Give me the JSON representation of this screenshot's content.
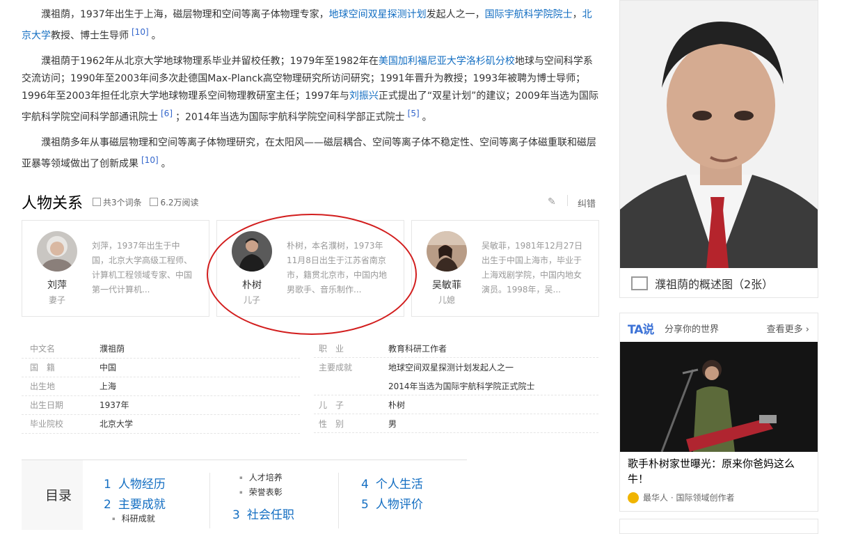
{
  "intro": {
    "p1": {
      "pre": "濮祖荫，1937年出生于上海，磁层物理和空间等离子体物理专家，",
      "link1": "地球空间双星探测计划",
      "mid1": "发起人之一，",
      "link2": "国际宇航科学院院士",
      "mid2": "，",
      "link3": "北京大学",
      "post": "教授、博士生导师",
      "ref": "[10]",
      "end": "。"
    },
    "p2": {
      "pre": "濮祖荫于1962年从北京大学地球物理系毕业并留校任教；1979年至1982年在",
      "link1": "美国加利福尼亚大学洛杉矶分校",
      "mid1": "地球与空间科学系交流访问；1990年至2003年间多次赴德国Max-Planck高空物理研究所访问研究；1991年晋升为教授；1993年被聘为博士导师；1996年至2003年担任北京大学地球物理系空间物理教研室主任；1997年与",
      "link2": "刘振兴",
      "mid2": "正式提出了“双星计划”的建议；2009年当选为国际宇航科学院空间科学部通讯院士",
      "ref1": "[6]",
      "mid3": "；2014年当选为国际宇航科学院空间科学部正式院士",
      "ref2": "[5]",
      "end": "。"
    },
    "p3": {
      "text": "濮祖荫多年从事磁层物理和空间等离子体物理研究，在太阳风——磁层耦合、空间等离子体不稳定性、空间等离子体磁重联和磁层亚暴等领域做出了创新成果",
      "ref": "[10]",
      "end": "。"
    }
  },
  "relations": {
    "title": "人物关系",
    "entries": "共3个词条",
    "views": "6.2万阅读",
    "fix": "纠错",
    "cards": [
      {
        "name": "刘萍",
        "role": "妻子",
        "desc": "刘萍，1937年出生于中国，北京大学高级工程师、计算机工程领域专家、中国第一代计算机..."
      },
      {
        "name": "朴树",
        "role": "儿子",
        "desc": "朴树，本名濮树，1973年11月8日出生于江苏省南京市，籍贯北京市，中国内地男歌手、音乐制作..."
      },
      {
        "name": "吴敏菲",
        "role": "儿媳",
        "desc": "吴敏菲，1981年12月27日出生于中国上海市，毕业于上海戏剧学院，中国内地女演员。1998年，吴..."
      }
    ]
  },
  "info": {
    "left": [
      {
        "k": "中文名",
        "v": "濮祖荫",
        "link": false
      },
      {
        "k": "国　籍",
        "v": "中国",
        "link": true
      },
      {
        "k": "出生地",
        "v": "上海",
        "link": false
      },
      {
        "k": "出生日期",
        "v": "1937年",
        "link": false
      },
      {
        "k": "毕业院校",
        "v": "北京大学",
        "link": true
      }
    ],
    "right": [
      {
        "k": "职　业",
        "v": "教育科研工作者",
        "link": false
      },
      {
        "k": "主要成就",
        "v": "地球空间双星探测计划发起人之一",
        "link": false
      },
      {
        "k": "",
        "v": "2014年当选为国际宇航科学院正式院士",
        "link": false
      },
      {
        "k": "儿　子",
        "v": "朴树",
        "link": true
      },
      {
        "k": "性　别",
        "v": "男",
        "link": false
      }
    ]
  },
  "toc": {
    "label": "目录",
    "items": [
      {
        "num": "1",
        "text": "人物经历"
      },
      {
        "num": "2",
        "text": "主要成就"
      },
      {
        "num": "3",
        "text": "社会任职"
      },
      {
        "num": "4",
        "text": "个人生活"
      },
      {
        "num": "5",
        "text": "人物评价"
      }
    ],
    "subs": [
      "科研成就",
      "人才培养",
      "荣誉表彰"
    ]
  },
  "sidebar": {
    "caption": "濮祖荫的概述图（2张）",
    "ta_logo": "TA说",
    "ta_sub": "分享你的世界",
    "ta_more": "查看更多 ›",
    "ta_title": "歌手朴树家世曝光：原来你爸妈这么牛！",
    "ta_author": "最华人 · 国际领域创作者"
  },
  "colors": {
    "link": "#136ec2",
    "circle": "#d21d1d",
    "ta_logo": "#3c72d6"
  }
}
